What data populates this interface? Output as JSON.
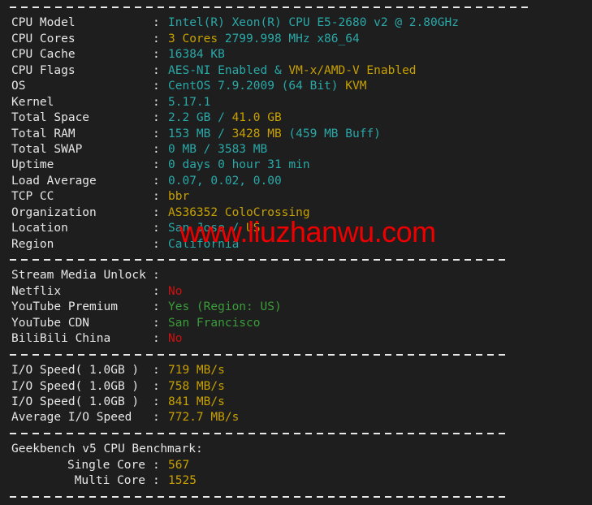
{
  "terminal": {
    "background": "#1e1e1e",
    "colors": {
      "label": "#e6e6e6",
      "cyan": "#2aa8a8",
      "yellow": "#c7a000",
      "green": "#3a9e3a",
      "red": "#cc1111",
      "watermark": "#ee0000"
    },
    "separator_char": "-",
    "colon": ":"
  },
  "watermark": {
    "text": "www.liuzhanwu.com"
  },
  "system_info": [
    {
      "label": "CPU Model",
      "value_cyan": "Intel(R) Xeon(R) CPU E5-2680 v2 @ 2.80GHz",
      "value_yellow": "",
      "value_cyan2": ""
    },
    {
      "label": "CPU Cores",
      "value_cyan": "",
      "value_yellow": "3 Cores ",
      "value_cyan2": "2799.998 MHz x86_64"
    },
    {
      "label": "CPU Cache",
      "value_cyan": "16384 KB",
      "value_yellow": "",
      "value_cyan2": ""
    },
    {
      "label": "CPU Flags",
      "value_cyan": "AES-NI Enabled & ",
      "value_yellow": "VM-x/AMD-V Enabled",
      "value_cyan2": ""
    },
    {
      "label": "OS",
      "value_cyan": "CentOS 7.9.2009 (64 Bit) ",
      "value_yellow": "KVM",
      "value_cyan2": ""
    },
    {
      "label": "Kernel",
      "value_cyan": "5.17.1",
      "value_yellow": "",
      "value_cyan2": ""
    },
    {
      "label": "Total Space",
      "value_cyan": "2.2 GB / ",
      "value_yellow": "41.0 GB",
      "value_cyan2": ""
    },
    {
      "label": "Total RAM",
      "value_cyan": "153 MB / ",
      "value_yellow": "3428 MB",
      "value_cyan2": " (459 MB Buff)"
    },
    {
      "label": "Total SWAP",
      "value_cyan": "0 MB / 3583 MB",
      "value_yellow": "",
      "value_cyan2": ""
    },
    {
      "label": "Uptime",
      "value_cyan": "0 days 0 hour 31 min",
      "value_yellow": "",
      "value_cyan2": ""
    },
    {
      "label": "Load Average",
      "value_cyan": "0.07, 0.02, 0.00",
      "value_yellow": "",
      "value_cyan2": ""
    },
    {
      "label": "TCP CC",
      "value_cyan": "",
      "value_yellow": "bbr",
      "value_cyan2": ""
    },
    {
      "label": "Organization",
      "value_cyan": "",
      "value_yellow": "AS36352 ColoCrossing",
      "value_cyan2": ""
    },
    {
      "label": "Location",
      "value_cyan": "San Jose / ",
      "value_yellow": "US",
      "value_cyan2": ""
    },
    {
      "label": "Region",
      "value_cyan": "California",
      "value_yellow": "",
      "value_cyan2": ""
    }
  ],
  "stream_media": {
    "heading_label": "Stream Media Unlock",
    "heading_value": "",
    "rows": [
      {
        "label": "Netflix",
        "value": "No",
        "color": "red"
      },
      {
        "label": "YouTube Premium",
        "value": "Yes (Region: US)",
        "color": "green"
      },
      {
        "label": "YouTube CDN",
        "value": "San Francisco",
        "color": "green"
      },
      {
        "label": "BiliBili China",
        "value": "No",
        "color": "red"
      }
    ]
  },
  "io_speed": [
    {
      "label": "I/O Speed( 1.0GB )",
      "value": "719 MB/s"
    },
    {
      "label": "I/O Speed( 1.0GB )",
      "value": "758 MB/s"
    },
    {
      "label": "I/O Speed( 1.0GB )",
      "value": "841 MB/s"
    },
    {
      "label": "Average I/O Speed",
      "value": "772.7 MB/s"
    }
  ],
  "geekbench": {
    "heading": "Geekbench v5 CPU Benchmark:",
    "rows": [
      {
        "label": "Single Core",
        "value": "567"
      },
      {
        "label": "Multi Core",
        "value": "1525"
      }
    ]
  }
}
